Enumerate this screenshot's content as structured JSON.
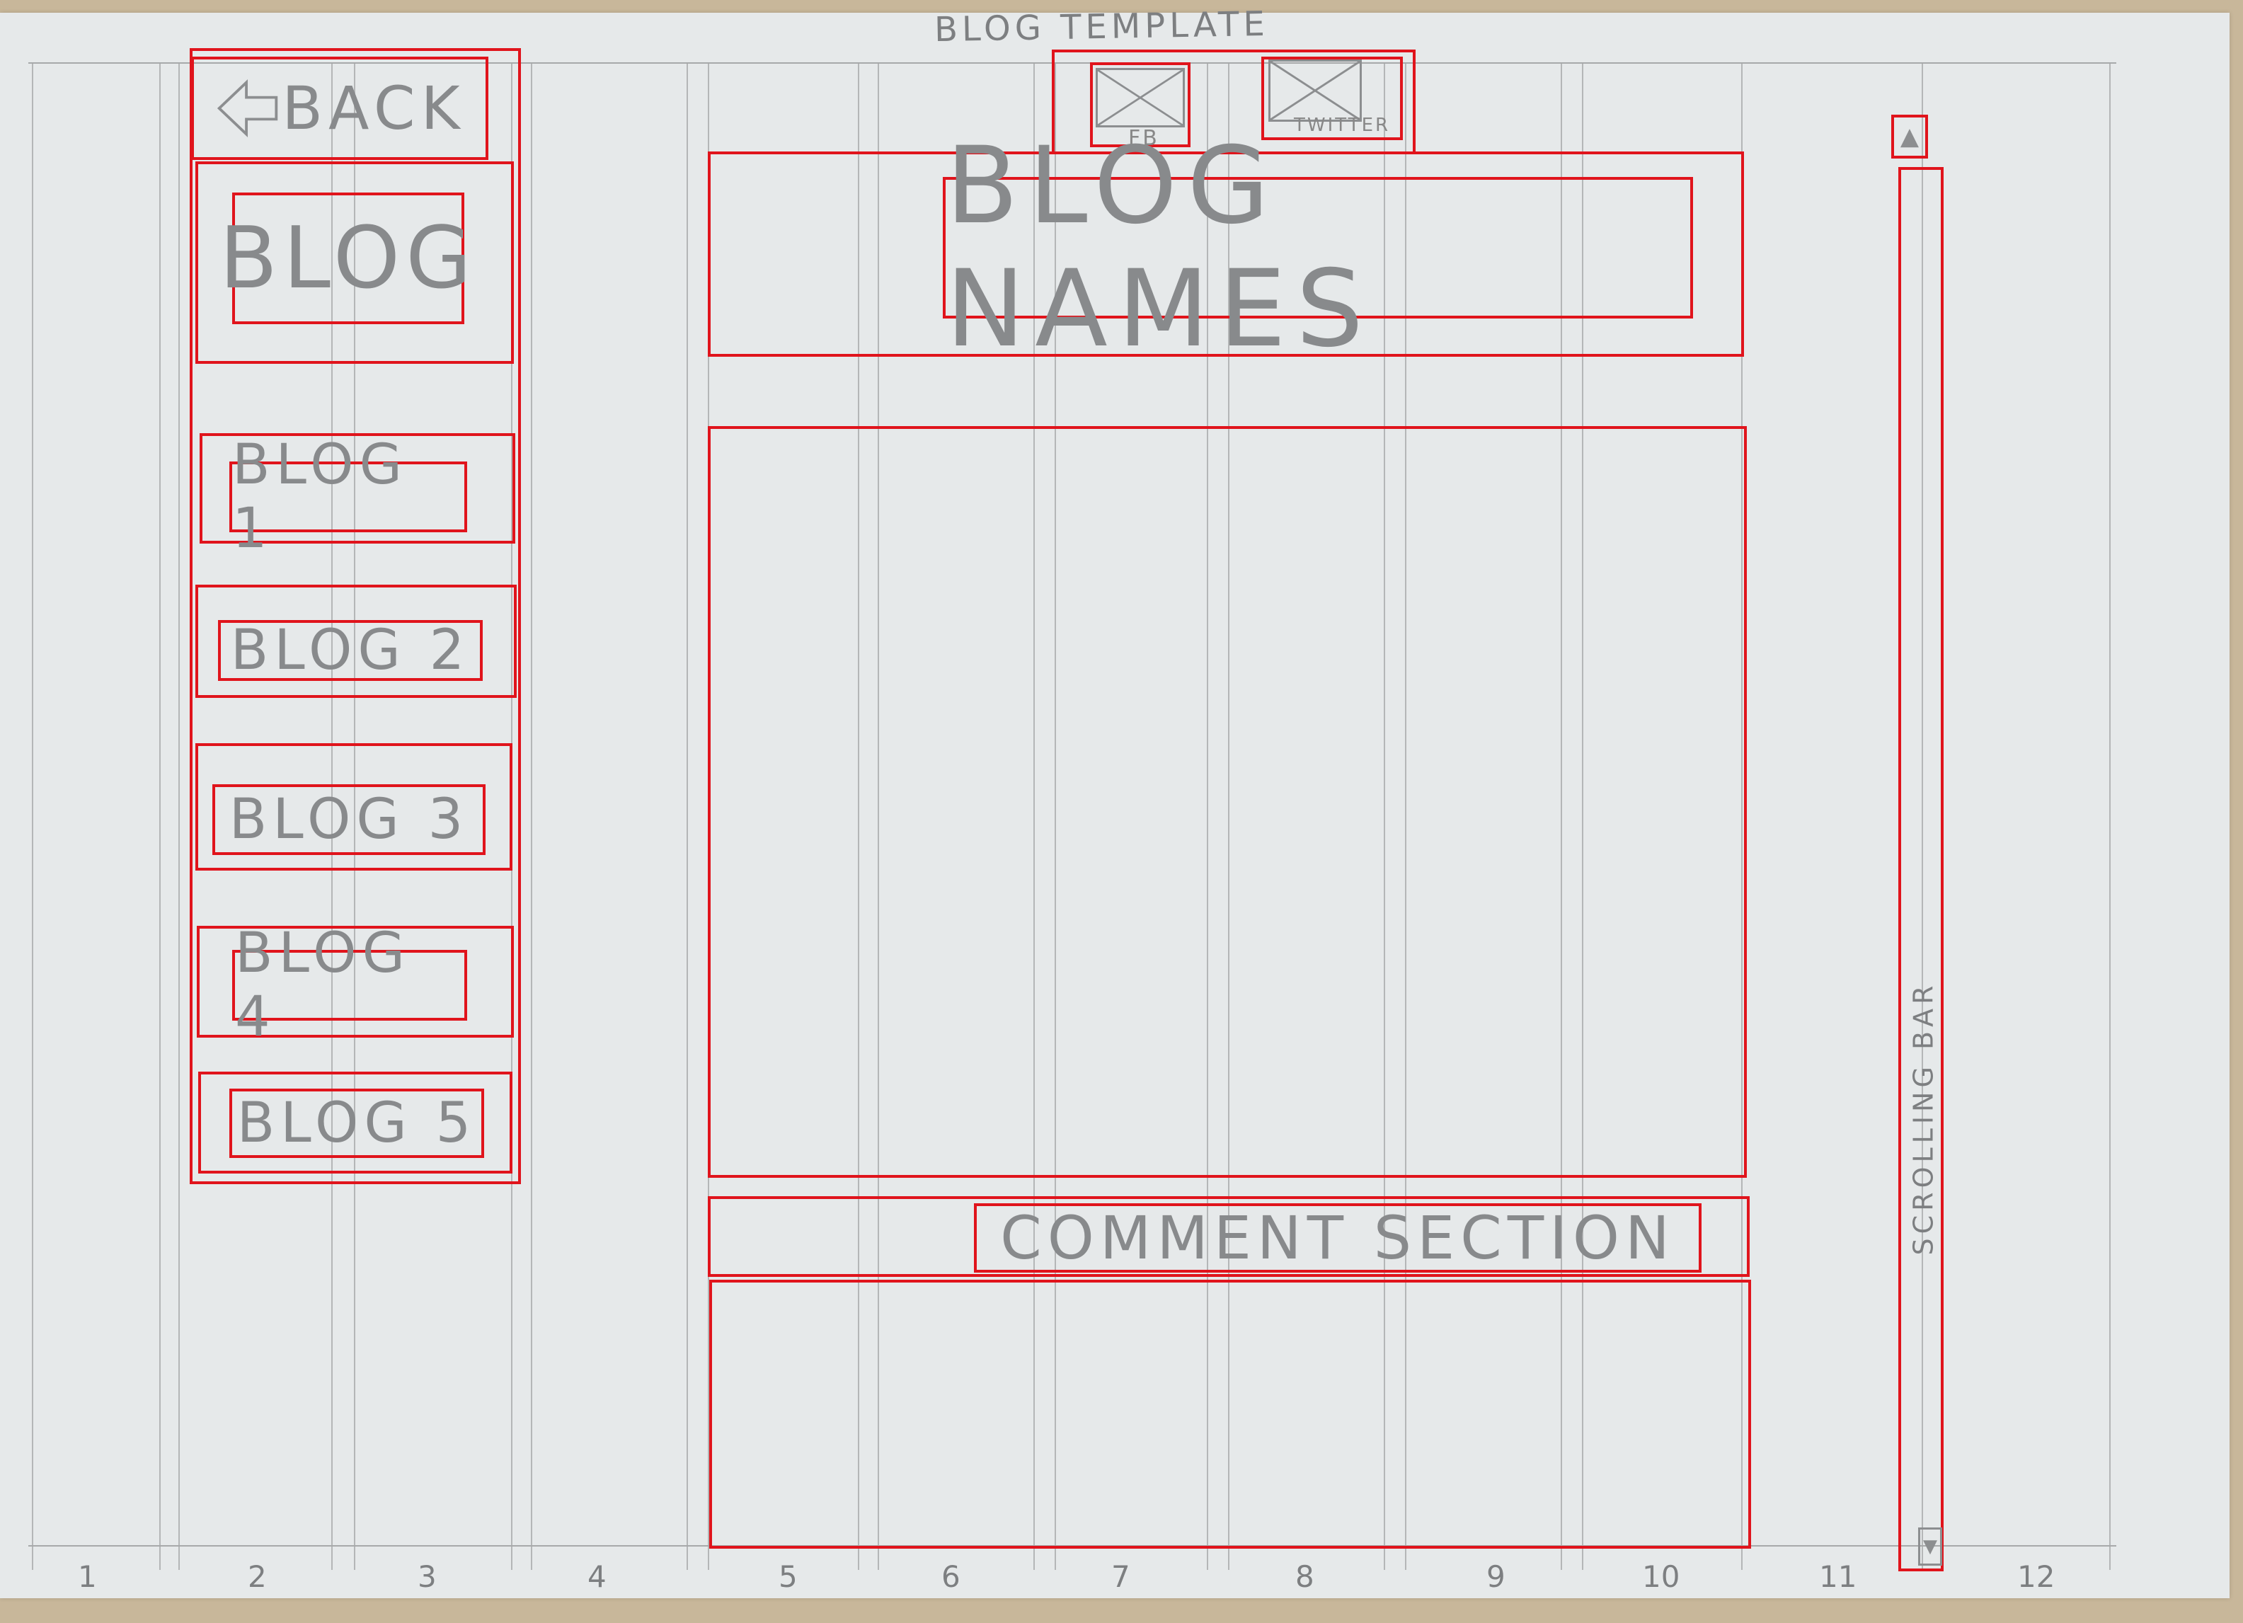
{
  "sheet_title": "BLOG TEMPLATE",
  "back_label": "BACK",
  "brand_label": "BLOG",
  "social": {
    "fb_label": "FB",
    "twitter_label": "TWITTER"
  },
  "blog_name": "BLOG NAMES",
  "sidebar_items": [
    "BLOG 1",
    "BLOG 2",
    "BLOG 3",
    "BLOG 4",
    "BLOG 5"
  ],
  "comment_header": "COMMENT SECTION",
  "scrollbar_label": "SCROLLING BAR",
  "grid_columns": [
    "1",
    "2",
    "3",
    "4",
    "5",
    "6",
    "7",
    "8",
    "9",
    "10",
    "11",
    "12"
  ],
  "colors": {
    "annotation": "#e0141c",
    "pencil": "#8c8e90",
    "paper": "#e6e9ea"
  }
}
